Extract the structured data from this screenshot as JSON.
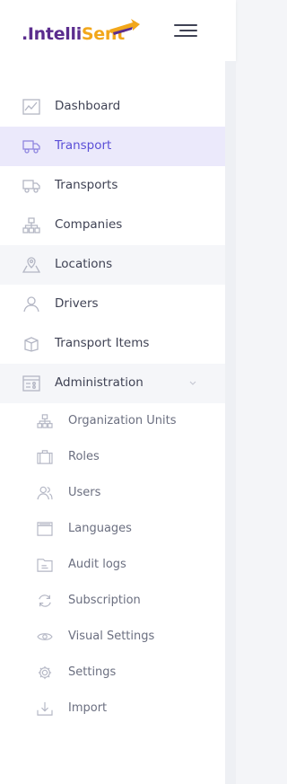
{
  "brand": {
    "name_part1": ".Intelli",
    "name_part2": "Sent",
    "colors": {
      "primary": "#5b2d8e",
      "accent": "#f2a71b"
    }
  },
  "header": {
    "menu_toggle_icon": "hamburger-icon"
  },
  "sidebar": {
    "active_color": "#5b4fd7",
    "items": [
      {
        "label": "Dashboard",
        "icon": "chart-line-icon",
        "state": "normal"
      },
      {
        "label": "Transport",
        "icon": "truck-icon",
        "state": "active"
      },
      {
        "label": "Transports",
        "icon": "truck-icon",
        "state": "normal"
      },
      {
        "label": "Companies",
        "icon": "org-chart-icon",
        "state": "normal"
      },
      {
        "label": "Locations",
        "icon": "map-marker-icon",
        "state": "hover"
      },
      {
        "label": "Drivers",
        "icon": "user-icon",
        "state": "normal"
      },
      {
        "label": "Transport Items",
        "icon": "box-icon",
        "state": "normal"
      },
      {
        "label": "Administration",
        "icon": "admin-panel-icon",
        "state": "expanded"
      }
    ],
    "admin_subitems": [
      {
        "label": "Organization Units",
        "icon": "org-chart-icon"
      },
      {
        "label": "Roles",
        "icon": "briefcase-icon"
      },
      {
        "label": "Users",
        "icon": "users-icon"
      },
      {
        "label": "Languages",
        "icon": "inbox-icon"
      },
      {
        "label": "Audit logs",
        "icon": "folder-icon"
      },
      {
        "label": "Subscription",
        "icon": "refresh-icon"
      },
      {
        "label": "Visual Settings",
        "icon": "eye-icon"
      },
      {
        "label": "Settings",
        "icon": "gear-icon"
      },
      {
        "label": "Import",
        "icon": "download-icon"
      }
    ]
  }
}
